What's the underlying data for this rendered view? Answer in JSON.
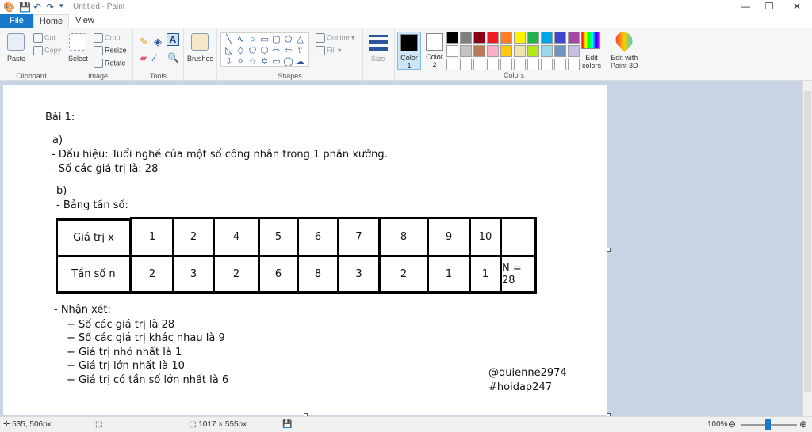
{
  "window": {
    "title": "Untitled - Paint",
    "minimize": "—",
    "restore": "❐",
    "close": "✕"
  },
  "tabs": {
    "file": "File",
    "home": "Home",
    "view": "View"
  },
  "ribbon": {
    "clipboard": {
      "label": "Clipboard",
      "paste": "Paste",
      "cut": "Cut",
      "copy": "Copy"
    },
    "image": {
      "label": "Image",
      "select": "Select",
      "crop": "Crop",
      "resize": "Resize",
      "rotate": "Rotate"
    },
    "tools": {
      "label": "Tools"
    },
    "brushes": {
      "label": "Brushes"
    },
    "shapes": {
      "label": "Shapes",
      "outline": "Outline",
      "fill": "Fill"
    },
    "size": {
      "label": "Size"
    },
    "color1": {
      "label": "Color",
      "num": "1"
    },
    "color2": {
      "label": "Color",
      "num": "2"
    },
    "colors": {
      "label": "Colors"
    },
    "edit_colors": {
      "line1": "Edit",
      "line2": "colors"
    },
    "paint3d": {
      "line1": "Edit with",
      "line2": "Paint 3D"
    },
    "palette": [
      "#000000",
      "#7f7f7f",
      "#880015",
      "#ed1c24",
      "#ff7f27",
      "#fff200",
      "#22b14c",
      "#00a2e8",
      "#3f48cc",
      "#a349a4",
      "#ffffff",
      "#c3c3c3",
      "#b97a57",
      "#ffaec9",
      "#ffc90e",
      "#efe4b0",
      "#b5e61d",
      "#99d9ea",
      "#7092be",
      "#c8bfe7",
      "#ffffff",
      "#ffffff",
      "#ffffff",
      "#ffffff",
      "#ffffff",
      "#ffffff",
      "#ffffff",
      "#ffffff",
      "#ffffff",
      "#ffffff"
    ]
  },
  "doc": {
    "bai": "Bài 1:",
    "a": "a)",
    "a1": "- Dấu hiệu: Tuổi nghề của một số công nhân trong 1 phân xưởng.",
    "a2": "- Số các giá trị là: 28",
    "b": "b)",
    "b1": "- Bảng tần số:",
    "row_x_label": "Giá trị x",
    "row_n_label": "Tần số n",
    "x_values": [
      "1",
      "2",
      "4",
      "5",
      "6",
      "7",
      "8",
      "9",
      "10",
      ""
    ],
    "n_values": [
      "2",
      "3",
      "2",
      "6",
      "8",
      "3",
      "2",
      "1",
      "1",
      "N = 28"
    ],
    "nhanxet": "- Nhận xét:",
    "nx1": "+ Số các giá trị là 28",
    "nx2": "+ Số các giá trị khác nhau là 9",
    "nx3": "+ Giá trị nhỏ nhất là 1",
    "nx4": "+ Giá trị lớn nhất là 10",
    "nx5": "+ Giá trị có tần số lớn nhất là 6",
    "sig1": "@quienne2974",
    "sig2": "#hoidap247"
  },
  "status": {
    "coords": "535, 506px",
    "size": "1017 × 555px",
    "zoom": "100%",
    "minus": "⊖",
    "plus": "⊕"
  }
}
